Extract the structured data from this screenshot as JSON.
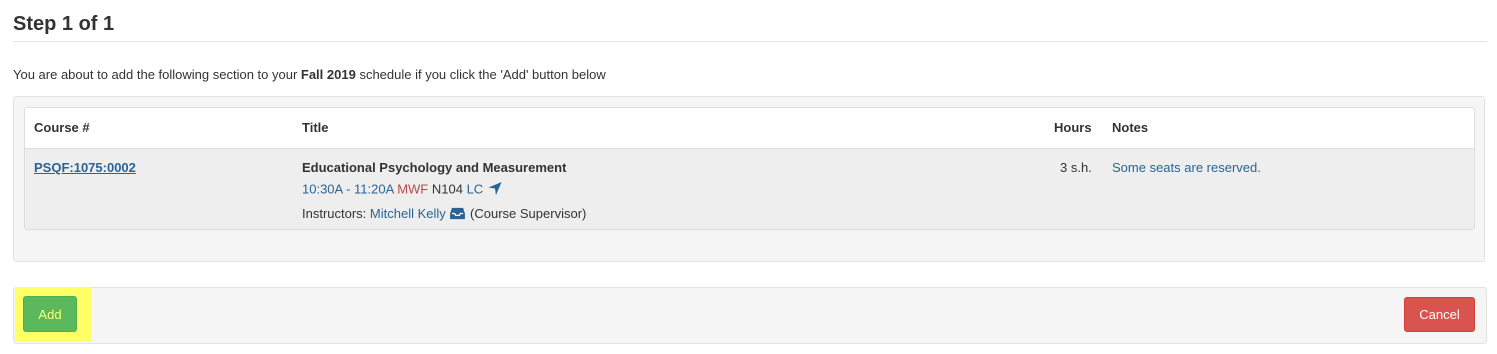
{
  "step": {
    "title": "Step 1 of 1"
  },
  "intro": {
    "before": "You are about to add the following section to your ",
    "term": "Fall 2019",
    "after": " schedule if you click the 'Add' button below"
  },
  "table": {
    "headers": {
      "course": "Course #",
      "title": "Title",
      "hours": "Hours",
      "notes": "Notes"
    },
    "row": {
      "course_number": "PSQF:1075:0002",
      "course_title": "Educational Psychology and Measurement",
      "time": "10:30A - 11:20A",
      "days": "MWF",
      "room": "N104",
      "building": "LC",
      "instructors_label": "Instructors: ",
      "instructor_name": "Mitchell Kelly",
      "instructor_role": "(Course Supervisor)",
      "hours": "3 s.h.",
      "notes": "Some seats are reserved."
    }
  },
  "icons": {
    "location": "location-arrow-icon",
    "email": "inbox-icon"
  },
  "buttons": {
    "add": "Add",
    "cancel": "Cancel"
  },
  "colors": {
    "add_button": "#5cb85c",
    "cancel_button": "#d9534f",
    "highlight": "#ffff66",
    "link": "#2a6496",
    "days": "#b94a48"
  }
}
